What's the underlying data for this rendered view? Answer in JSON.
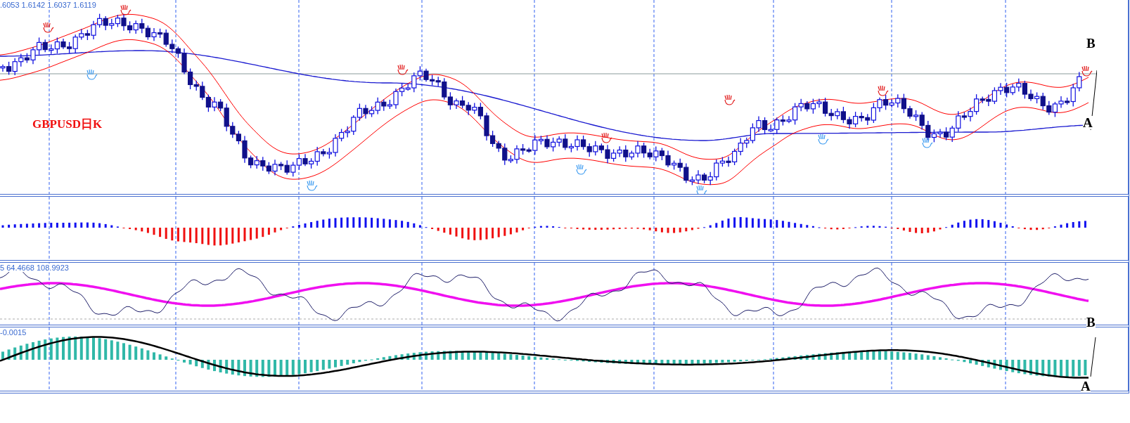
{
  "main_panel": {
    "price_readout": ".6053 1.6142 1.6037 1.6119",
    "symbol_label": "GBPUSD日K",
    "annotation_top": "B",
    "annotation_bottom": "A"
  },
  "oscillator_panel": {
    "readout": "5 64.4668 108.9923",
    "annotation": "B"
  },
  "macd_panel": {
    "readout": "-0.0015",
    "annotation": "A"
  }
}
